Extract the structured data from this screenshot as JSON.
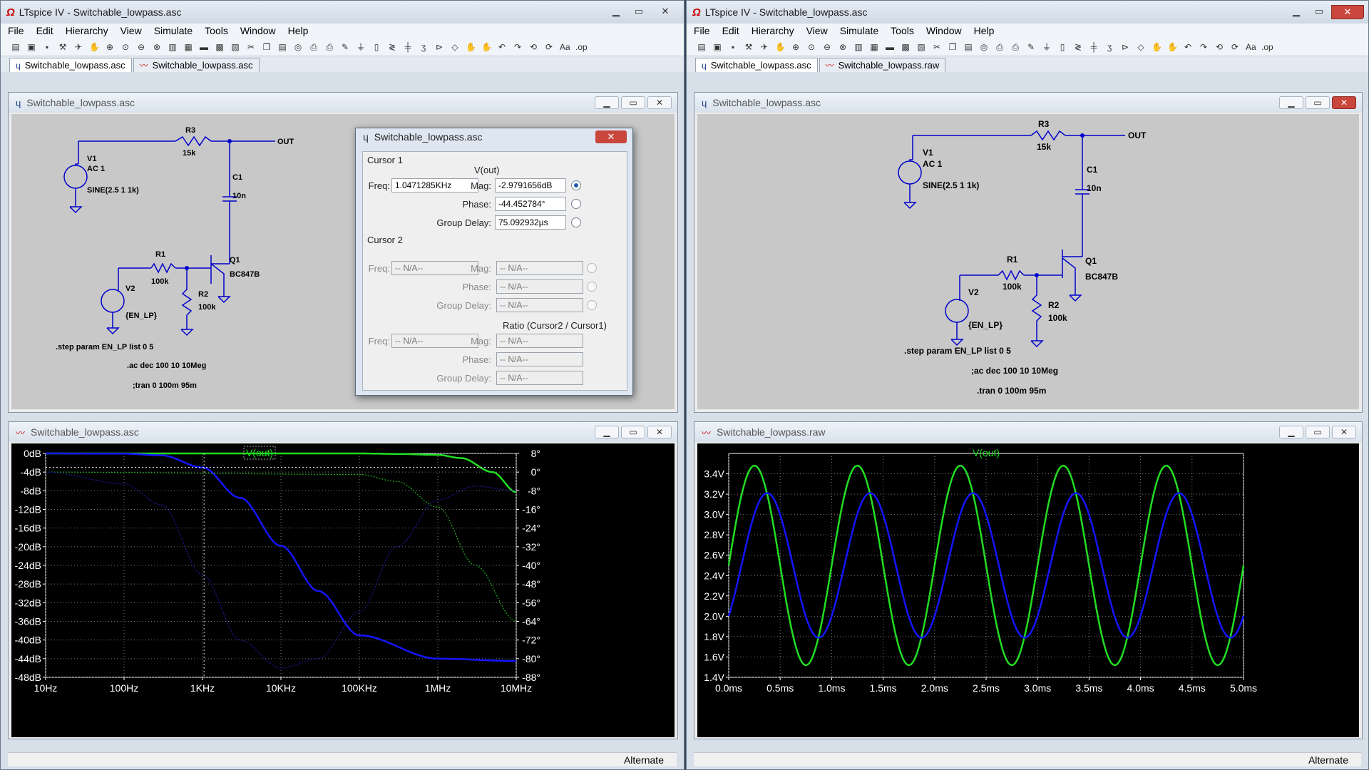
{
  "left_app": {
    "title": "LTspice IV - Switchable_lowpass.asc",
    "menu": [
      "File",
      "Edit",
      "Hierarchy",
      "View",
      "Simulate",
      "Tools",
      "Window",
      "Help"
    ],
    "tabs": [
      "Switchable_lowpass.asc",
      "Switchable_lowpass.asc"
    ],
    "schematic_window_title": "Switchable_lowpass.asc",
    "plot_window_title": "Switchable_lowpass.asc",
    "status": "Alternate"
  },
  "right_app": {
    "title": "LTspice IV - Switchable_lowpass.asc",
    "menu": [
      "File",
      "Edit",
      "Hierarchy",
      "View",
      "Simulate",
      "Tools",
      "Window",
      "Help"
    ],
    "tabs": [
      "Switchable_lowpass.asc",
      "Switchable_lowpass.raw"
    ],
    "schematic_window_title": "Switchable_lowpass.asc",
    "plot_window_title": "Switchable_lowpass.raw",
    "status": "Alternate"
  },
  "schematic": {
    "r3_name": "R3",
    "r3_val": "15k",
    "out": "OUT",
    "v1_name": "V1",
    "v1_ac": "AC 1",
    "v1_sine": "SINE(2.5 1 1k)",
    "c1_name": "C1",
    "c1_val": "10n",
    "r1_name": "R1",
    "r1_val": "100k",
    "q1_name": "Q1",
    "q1_val": "BC847B",
    "r2_name": "R2",
    "r2_val": "100k",
    "v2_name": "V2",
    "v2_val": "{EN_LP}",
    "step": ".step param EN_LP list 0 5",
    "ac_left": ".ac dec 100 10 10Meg",
    "tran_left": ";tran 0 100m 95m",
    "ac_right": ";ac dec 100 10 10Meg",
    "tran_right": ".tran 0 100m 95m"
  },
  "cursor_dialog": {
    "title": "Switchable_lowpass.asc",
    "cursor1_label": "Cursor 1",
    "trace": "V(out)",
    "freq_label": "Freq:",
    "freq": "1.0471285KHz",
    "mag_label": "Mag:",
    "mag": "-2.9791656dB",
    "phase_label": "Phase:",
    "phase": "-44.452784°",
    "gd_label": "Group Delay:",
    "gd": "75.092932µs",
    "cursor2_label": "Cursor 2",
    "na": "-- N/A--",
    "ratio_label": "Ratio (Cursor2 / Cursor1)"
  },
  "chart_data": [
    {
      "type": "line",
      "title": "V(out)",
      "x_scale": "log",
      "x_ticks": [
        "10Hz",
        "100Hz",
        "1KHz",
        "10KHz",
        "100KHz",
        "1MHz",
        "10MHz"
      ],
      "xlim": [
        10,
        10000000
      ],
      "y_ticks_left": [
        "0dB",
        "-4dB",
        "-8dB",
        "-12dB",
        "-16dB",
        "-20dB",
        "-24dB",
        "-28dB",
        "-32dB",
        "-36dB",
        "-40dB",
        "-44dB",
        "-48dB"
      ],
      "ylim_left": [
        -48,
        0
      ],
      "y_ticks_right": [
        "8°",
        "0°",
        "-8°",
        "-16°",
        "-24°",
        "-32°",
        "-40°",
        "-48°",
        "-56°",
        "-64°",
        "-72°",
        "-80°",
        "-88°"
      ],
      "ylim_right": [
        -88,
        8
      ],
      "cursor": {
        "freq": 1047.1285,
        "mag_db": -2.98
      },
      "series": [
        {
          "role": "magnitude EN_LP=0",
          "color": "#22dd22",
          "x": [
            10,
            1000,
            10000,
            100000,
            300000,
            1000000,
            2000000,
            5000000,
            10000000
          ],
          "y": [
            0,
            0,
            0,
            0,
            -0.1,
            -0.3,
            -1.0,
            -4.0,
            -8.3
          ]
        },
        {
          "role": "magnitude EN_LP=5",
          "color": "#1515ff",
          "x": [
            10,
            100,
            300,
            1000,
            3000,
            10000,
            30000,
            100000,
            1000000,
            10000000
          ],
          "y": [
            0,
            -0.05,
            -0.4,
            -3.0,
            -9.5,
            -19.8,
            -29.5,
            -39.0,
            -44.0,
            -44.5
          ]
        },
        {
          "role": "phase EN_LP=0",
          "color": "#22aa22",
          "dashed": true,
          "x": [
            10,
            100000,
            300000,
            1000000,
            3000000,
            10000000
          ],
          "y": [
            0,
            -1,
            -4,
            -15,
            -40,
            -64
          ]
        },
        {
          "role": "phase EN_LP=5",
          "color": "#1a1a99",
          "dashed": true,
          "x": [
            10,
            100,
            300,
            1000,
            3000,
            10000,
            30000,
            100000,
            300000,
            1000000,
            3000000,
            10000000
          ],
          "y": [
            0,
            -5,
            -14,
            -44,
            -72,
            -84,
            -80,
            -60,
            -32,
            -12,
            -6,
            -8
          ]
        }
      ]
    },
    {
      "type": "line",
      "title": "V(out)",
      "x_ticks": [
        "0.0ms",
        "0.5ms",
        "1.0ms",
        "1.5ms",
        "2.0ms",
        "2.5ms",
        "3.0ms",
        "3.5ms",
        "4.0ms",
        "4.5ms",
        "5.0ms"
      ],
      "xlim": [
        0,
        5
      ],
      "y_ticks": [
        "3.4V",
        "3.2V",
        "3.0V",
        "2.8V",
        "2.6V",
        "2.4V",
        "2.2V",
        "2.0V",
        "1.8V",
        "1.6V",
        "1.4V"
      ],
      "ylim": [
        1.4,
        3.6
      ],
      "series": [
        {
          "role": "EN_LP=0",
          "color": "#22dd22",
          "offset": 2.5,
          "amplitude": 0.98,
          "freq_khz": 1,
          "phase_deg": 0
        },
        {
          "role": "EN_LP=5",
          "color": "#1515ff",
          "offset": 2.5,
          "amplitude": 0.71,
          "freq_khz": 1,
          "phase_deg": -44.5
        }
      ]
    }
  ]
}
